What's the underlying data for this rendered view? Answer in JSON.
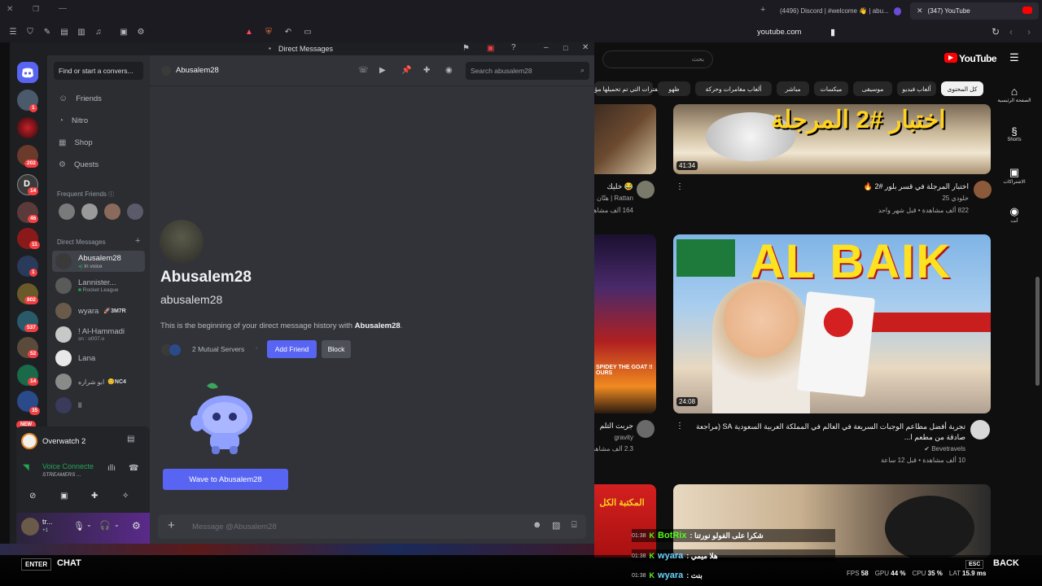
{
  "browser": {
    "tabs": [
      {
        "label": "(4496) Discord | #welcome 👋 | abu..."
      },
      {
        "label": "(347) YouTube"
      }
    ],
    "url": "youtube.com"
  },
  "youtube": {
    "logo": "YouTube",
    "search_placeholder": "بحث",
    "chips": [
      "كل المحتوى",
      "ألعاب فيديو",
      "موسيقى",
      "ميكسات",
      "مباشر",
      "ألعاب مغامرات وحركة",
      "طهو",
      "الفترات التي تم تحميلها مؤخرًا"
    ],
    "nav": [
      {
        "label": "الصفحة الرئيسية"
      },
      {
        "label": "Shorts"
      },
      {
        "label": "الاشتراكات"
      },
      {
        "label": "أنت"
      }
    ],
    "videos": [
      {
        "title": "اختبار المرجلة في قسر بلور #2 🔥",
        "channel": "خلودي 25",
        "meta": "822 ألف مشاهدة • قبل شهر واحد",
        "duration": "41:34",
        "thumb_text": "اختبار #2 المرجلة"
      },
      {
        "title": "😂 خليك",
        "channel": "Rattan | هتّان",
        "meta": "164 ألف مشاهدة",
        "duration": ""
      },
      {
        "title": "تجربة أفضل مطاعم الوجبات السريعة في العالم في المملكة العربية السعودية SA (مراجعة صادقة من مطعم ا...",
        "channel": "Bevetravels",
        "meta": "10 ألف مشاهدة • قبل 12 ساعة",
        "duration": "24:08",
        "thumb_text": "AL BAIK"
      },
      {
        "title": "جربت التلم",
        "channel": "gravity",
        "meta": "2.3 ألف مشاهدة",
        "duration": "",
        "thumb_text": "SPIDEY THE GOAT !! OURS"
      },
      {
        "title": "",
        "channel": "",
        "meta": "",
        "duration": "",
        "thumb_text": "المكتبة الكل"
      }
    ]
  },
  "discord": {
    "window_title": "Direct Messages",
    "search_box": "Find or start a convers...",
    "nav": [
      {
        "label": "Friends"
      },
      {
        "label": "Nitro"
      },
      {
        "label": "Shop"
      },
      {
        "label": "Quests"
      }
    ],
    "frequent_friends": "Frequent Friends",
    "direct_messages": "Direct Messages",
    "dms": [
      {
        "name": "Abusalem28",
        "sub": "In voice"
      },
      {
        "name": "Lannister...",
        "sub": "Rocket League"
      },
      {
        "name": "wyara",
        "sub": "3M7R"
      },
      {
        "name": "! Al-Hammadi",
        "sub": "sn : o007.o"
      },
      {
        "name": "Lana",
        "sub": ""
      },
      {
        "name": "ابو شراره",
        "sub": "NC4"
      },
      {
        "name": "ll",
        "sub": ""
      }
    ],
    "guild_badges": [
      "1",
      "202",
      "14",
      "46",
      "11",
      "1",
      "802",
      "537",
      "52",
      "14",
      "35",
      "NEW"
    ],
    "activity": {
      "game": "Overwatch 2"
    },
    "voice": {
      "status": "Voice Connecte",
      "server": "STREAMERS ..."
    },
    "user": {
      "name": "tr...",
      "sub": "+1"
    },
    "chat": {
      "header_name": "Abusalem28",
      "search_placeholder": "Search abusalem28",
      "display_name": "Abusalem28",
      "username": "abusalem28",
      "intro_prefix": "This is the beginning of your direct message history with ",
      "intro_name": "Abusalem28",
      "intro_suffix": ".",
      "mutual": "2 Mutual Servers",
      "add_friend": "Add Friend",
      "block": "Block",
      "wave": "Wave to Abusalem28",
      "message_placeholder": "Message @Abusalem28"
    }
  },
  "overlay": {
    "enter": "ENTER",
    "chat": "CHAT",
    "esc": "ESC",
    "back": "BACK",
    "chat_lines": [
      {
        "time": "01:38",
        "user": "BotRix",
        "text": "شكرا على الفولو نورتنا :"
      },
      {
        "time": "01:38",
        "user": "wyara",
        "text": "هلا ميمي :"
      },
      {
        "time": "01:38",
        "user": "wyara",
        "text": "بنت :"
      }
    ],
    "stats": {
      "fps_label": "FPS",
      "fps": "58",
      "gpu_label": "GPU",
      "gpu": "44 %",
      "cpu_label": "CPU",
      "cpu": "35 %",
      "lat_label": "LAT",
      "lat": "15.9 ms"
    }
  },
  "colors": {
    "discord_blurple": "#5865f2",
    "youtube_red": "#ff0000"
  }
}
